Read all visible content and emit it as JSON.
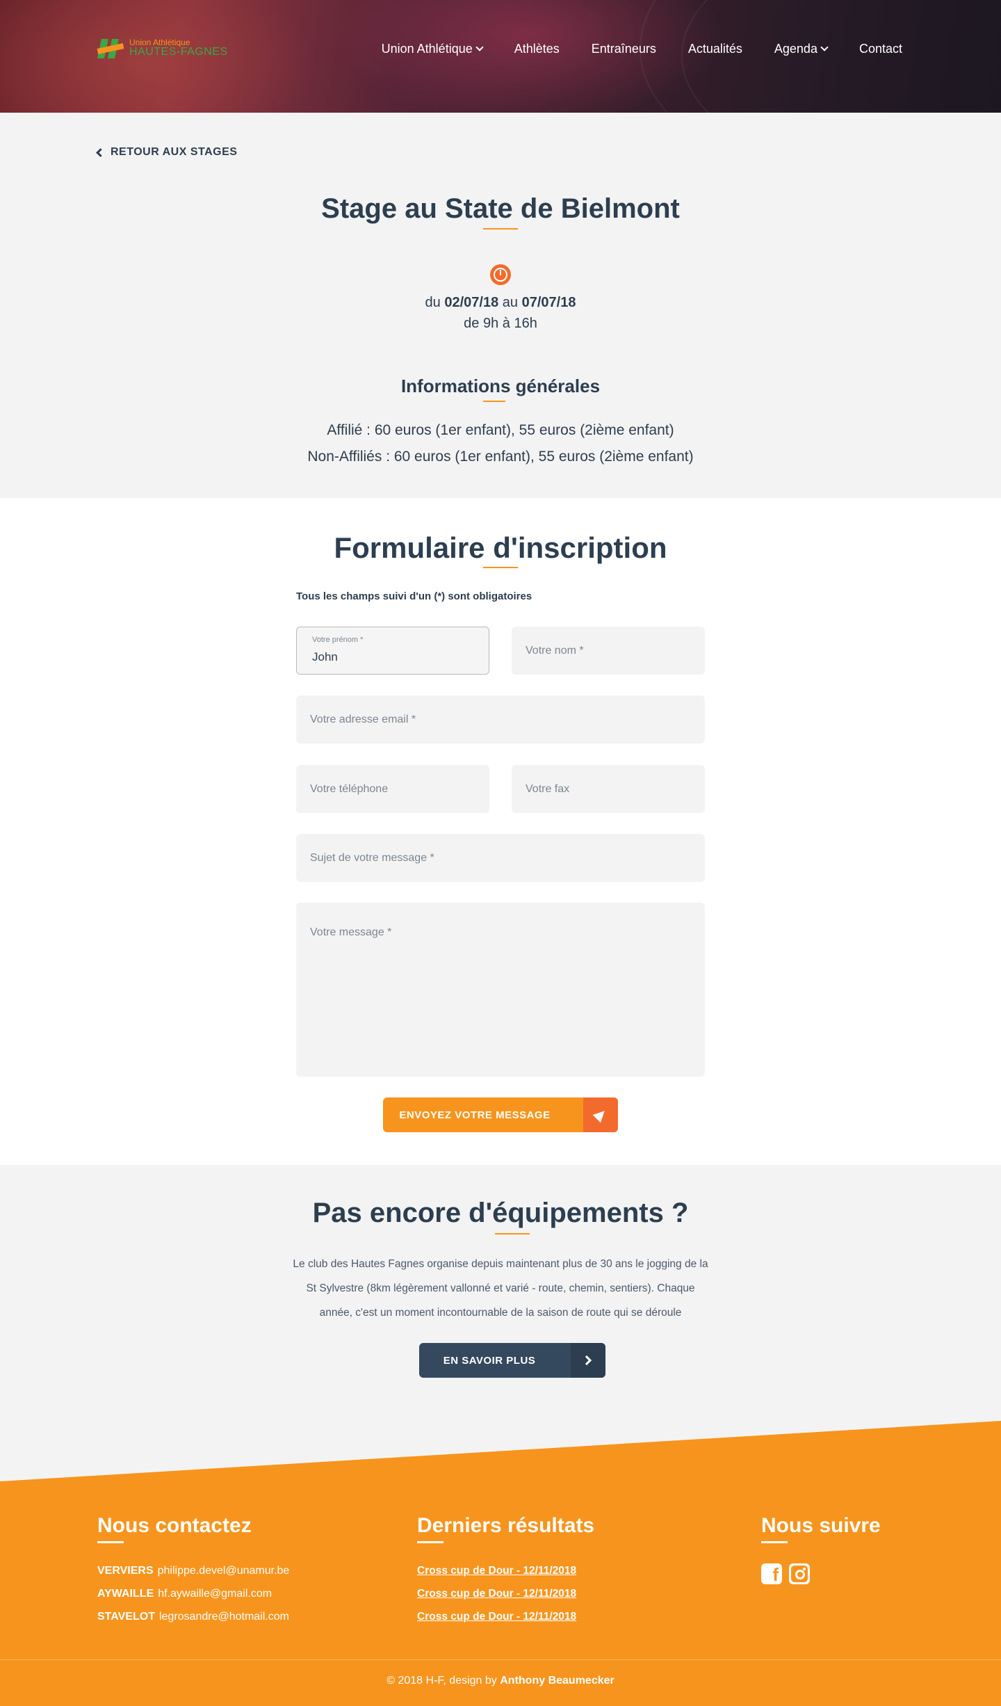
{
  "brand": {
    "line1": "Union Athlétique",
    "line2": "HAUTES-FAGNES"
  },
  "nav": {
    "items": [
      {
        "label": "Union Athlétique",
        "dropdown": true
      },
      {
        "label": "Athlètes",
        "dropdown": false
      },
      {
        "label": "Entraîneurs",
        "dropdown": false
      },
      {
        "label": "Actualités",
        "dropdown": false
      },
      {
        "label": "Agenda",
        "dropdown": true
      },
      {
        "label": "Contact",
        "dropdown": false
      }
    ]
  },
  "stage": {
    "back_label": "RETOUR AUX STAGES",
    "title": "Stage au State de Bielmont",
    "date_prefix": "du",
    "date_start": "02/07/18",
    "date_mid": "au",
    "date_end": "07/07/18",
    "hours": "de 9h à 16h",
    "info_title": "Informations générales",
    "info_lines": [
      "Affilié : 60 euros (1er enfant), 55 euros (2ième enfant)",
      "Non-Affiliés : 60 euros (1er enfant), 55 euros (2ième enfant)"
    ]
  },
  "form": {
    "title": "Formulaire d'inscription",
    "required_note": "Tous les champs suivi d'un (*) sont obligatoires",
    "firstname_label": "Votre prénom *",
    "firstname_value": "John",
    "lastname_placeholder": "Votre nom *",
    "email_placeholder": "Votre adresse email *",
    "phone_placeholder": "Votre téléphone",
    "fax_placeholder": "Votre fax",
    "subject_placeholder": "Sujet de votre message *",
    "message_placeholder": "Votre message *",
    "submit_label": "ENVOYEZ VOTRE MESSAGE"
  },
  "equipment": {
    "title": "Pas encore d'équipements ?",
    "text": "Le club des Hautes Fagnes organise depuis maintenant plus de 30 ans le jogging de la St Sylvestre (8km légèrement vallonné et varié - route, chemin, sentiers). Chaque année, c'est un moment incontournable de la saison de route qui se déroule",
    "button_label": "EN SAVOIR PLUS"
  },
  "footer": {
    "contact_title": "Nous contactez",
    "contacts": [
      {
        "city": "VERVIERS",
        "email": "philippe.devel@unamur.be"
      },
      {
        "city": "AYWAILLE",
        "email": "hf.aywaille@gmail.com"
      },
      {
        "city": "STAVELOT",
        "email": "legrosandre@hotmail.com"
      }
    ],
    "results_title": "Derniers résultats",
    "results": [
      "Cross cup de Dour - 12/11/2018",
      "Cross cup de Dour - 12/11/2018",
      "Cross cup de Dour - 12/11/2018"
    ],
    "follow_title": "Nous suivre",
    "social": [
      "facebook-icon",
      "instagram-icon"
    ],
    "copyright_prefix": "© 2018 H-F, design by",
    "copyright_author": "Anthony Beaumecker"
  },
  "colors": {
    "accent": "#f7941d",
    "accent_dark": "#f26b2c",
    "navy": "#2c3e50",
    "light_bg": "#f3f3f3"
  }
}
